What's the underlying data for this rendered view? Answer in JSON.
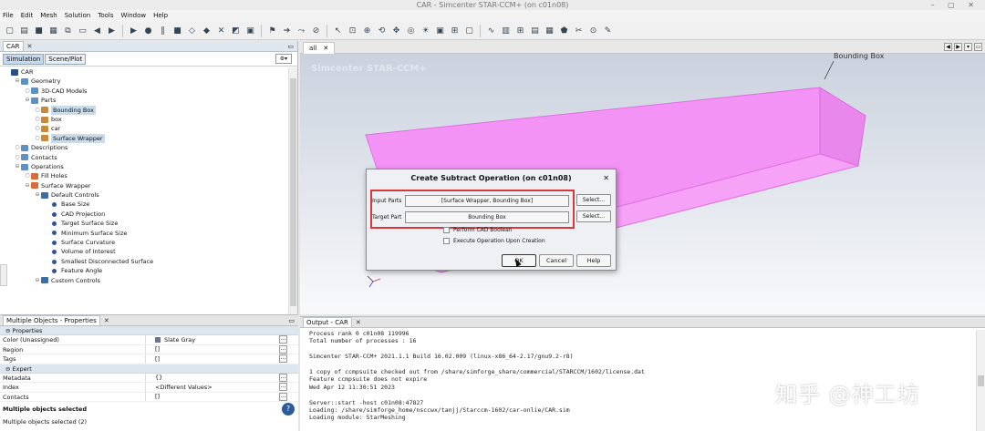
{
  "window": {
    "title": "CAR - Simcenter STAR-CCM+ (on c01n08)"
  },
  "menu": [
    "File",
    "Edit",
    "Mesh",
    "Solution",
    "Tools",
    "Window",
    "Help"
  ],
  "toolbar_icons": [
    "new-file-icon",
    "open-file-icon",
    "save-icon",
    "save-as-icon",
    "copy-icon",
    "paste-icon",
    "undo-icon",
    "redo-icon",
    "play-icon",
    "record-icon",
    "pause-icon",
    "stop-icon",
    "mesh-icon",
    "mesh-generate-icon",
    "mesh-clear-icon",
    "surface-icon",
    "volume-icon",
    "flag-icon",
    "run-icon",
    "step-icon",
    "stop-run-icon",
    "cursor-icon",
    "zoom-fit-icon",
    "zoom-icon",
    "rotate-icon",
    "pan-icon",
    "view-icon",
    "light-icon",
    "camera-icon",
    "grid-icon",
    "select-icon",
    "plot-icon",
    "monitor-icon",
    "table-icon",
    "report-icon",
    "table2-icon",
    "scene-icon",
    "cut-icon",
    "probe-icon",
    "annotate-icon"
  ],
  "left_panel": {
    "tab_label": "CAR",
    "subtabs": [
      "Simulation",
      "Scene/Plot"
    ],
    "tree": [
      {
        "level": 0,
        "label": "CAR",
        "icon": "car"
      },
      {
        "level": 1,
        "label": "Geometry",
        "icon": "folder",
        "toggle": "-"
      },
      {
        "level": 2,
        "label": "3D-CAD Models",
        "icon": "folder"
      },
      {
        "level": 2,
        "label": "Parts",
        "icon": "folder",
        "toggle": "-"
      },
      {
        "level": 3,
        "label": "Bounding Box",
        "icon": "part",
        "selected": true
      },
      {
        "level": 3,
        "label": "box",
        "icon": "part"
      },
      {
        "level": 3,
        "label": "car",
        "icon": "part"
      },
      {
        "level": 3,
        "label": "Surface Wrapper",
        "icon": "part",
        "selected": true
      },
      {
        "level": 1,
        "label": "Descriptions",
        "icon": "folder"
      },
      {
        "level": 1,
        "label": "Contacts",
        "icon": "folder"
      },
      {
        "level": 1,
        "label": "Operations",
        "icon": "folder",
        "toggle": "-"
      },
      {
        "level": 2,
        "label": "Fill Holes",
        "icon": "op"
      },
      {
        "level": 2,
        "label": "Surface Wrapper",
        "icon": "op",
        "toggle": "-"
      },
      {
        "level": 3,
        "label": "Default Controls",
        "icon": "cont",
        "toggle": "-"
      },
      {
        "level": 4,
        "label": "Base Size",
        "icon": "dot"
      },
      {
        "level": 4,
        "label": "CAD Projection",
        "icon": "dot"
      },
      {
        "level": 4,
        "label": "Target Surface Size",
        "icon": "dot"
      },
      {
        "level": 4,
        "label": "Minimum Surface Size",
        "icon": "dot"
      },
      {
        "level": 4,
        "label": "Surface Curvature",
        "icon": "dot"
      },
      {
        "level": 4,
        "label": "Volume of Interest",
        "icon": "dot"
      },
      {
        "level": 4,
        "label": "Smallest Disconnected Surface",
        "icon": "dot"
      },
      {
        "level": 4,
        "label": "Feature Angle",
        "icon": "dot"
      },
      {
        "level": 3,
        "label": "Custom Controls",
        "icon": "cont",
        "toggle": "-"
      }
    ]
  },
  "properties": {
    "tab_label": "Multiple Objects - Properties",
    "sections": [
      {
        "title": "Properties",
        "rows": [
          {
            "name": "Color   (Unassigned)",
            "value": "Slate Gray",
            "swatch": true
          },
          {
            "name": "Region",
            "value": "[]"
          },
          {
            "name": "Tags",
            "value": "[]"
          }
        ]
      },
      {
        "title": "Expert",
        "rows": [
          {
            "name": "Metadata",
            "value": "{}"
          },
          {
            "name": "Index",
            "value": "<Different Values>"
          },
          {
            "name": "Contacts",
            "value": "[]"
          }
        ]
      }
    ],
    "status_title": "Multiple objects selected",
    "status_sub": "Multiple objects selected (2)"
  },
  "viewport": {
    "tab_label": "all",
    "brand": "Simcenter STAR-CCM+",
    "annotation": "Bounding Box"
  },
  "dialog": {
    "title": "Create Subtract Operation (on c01n08)",
    "input_parts_label": "Input Parts",
    "input_parts_value": "[Surface Wrapper, Bounding Box]",
    "target_part_label": "Target Part",
    "target_part_value": "Bounding Box",
    "select_label": "Select...",
    "cad_boolean_label": "Perform CAD Boolean",
    "execute_label": "Execute Operation Upon Creation",
    "ok_label": "OK",
    "cancel_label": "Cancel",
    "help_label": "Help"
  },
  "output": {
    "tab_label": "Output - CAR",
    "lines": [
      "Process rank 0 c01n08 119996",
      "Total number of processes : 16",
      "",
      "Simcenter STAR-CCM+ 2021.1.1 Build 16.02.009 (linux-x86_64-2.17/gnu9.2-r8)",
      "",
      "1 copy of ccmpsuite checked out from /share/simforge_share/commercial/STARCCM/1602/license.dat",
      "Feature ccmpsuite does not expire",
      "Wed Apr 12 11:30:51 2023",
      "",
      "Server::start -host c01n08:47827",
      "Loading: /share/simforge_home/nsccwx/tanjj/Starccm-1602/car-onlie/CAR.sim",
      "Loading module: StarMeshing"
    ]
  },
  "watermark": "知乎 @神工坊",
  "colors": {
    "part_fill": "#f08ef2",
    "part_edge": "#e070e3",
    "highlight": "#d5393d",
    "selection": "#c9dcec"
  }
}
